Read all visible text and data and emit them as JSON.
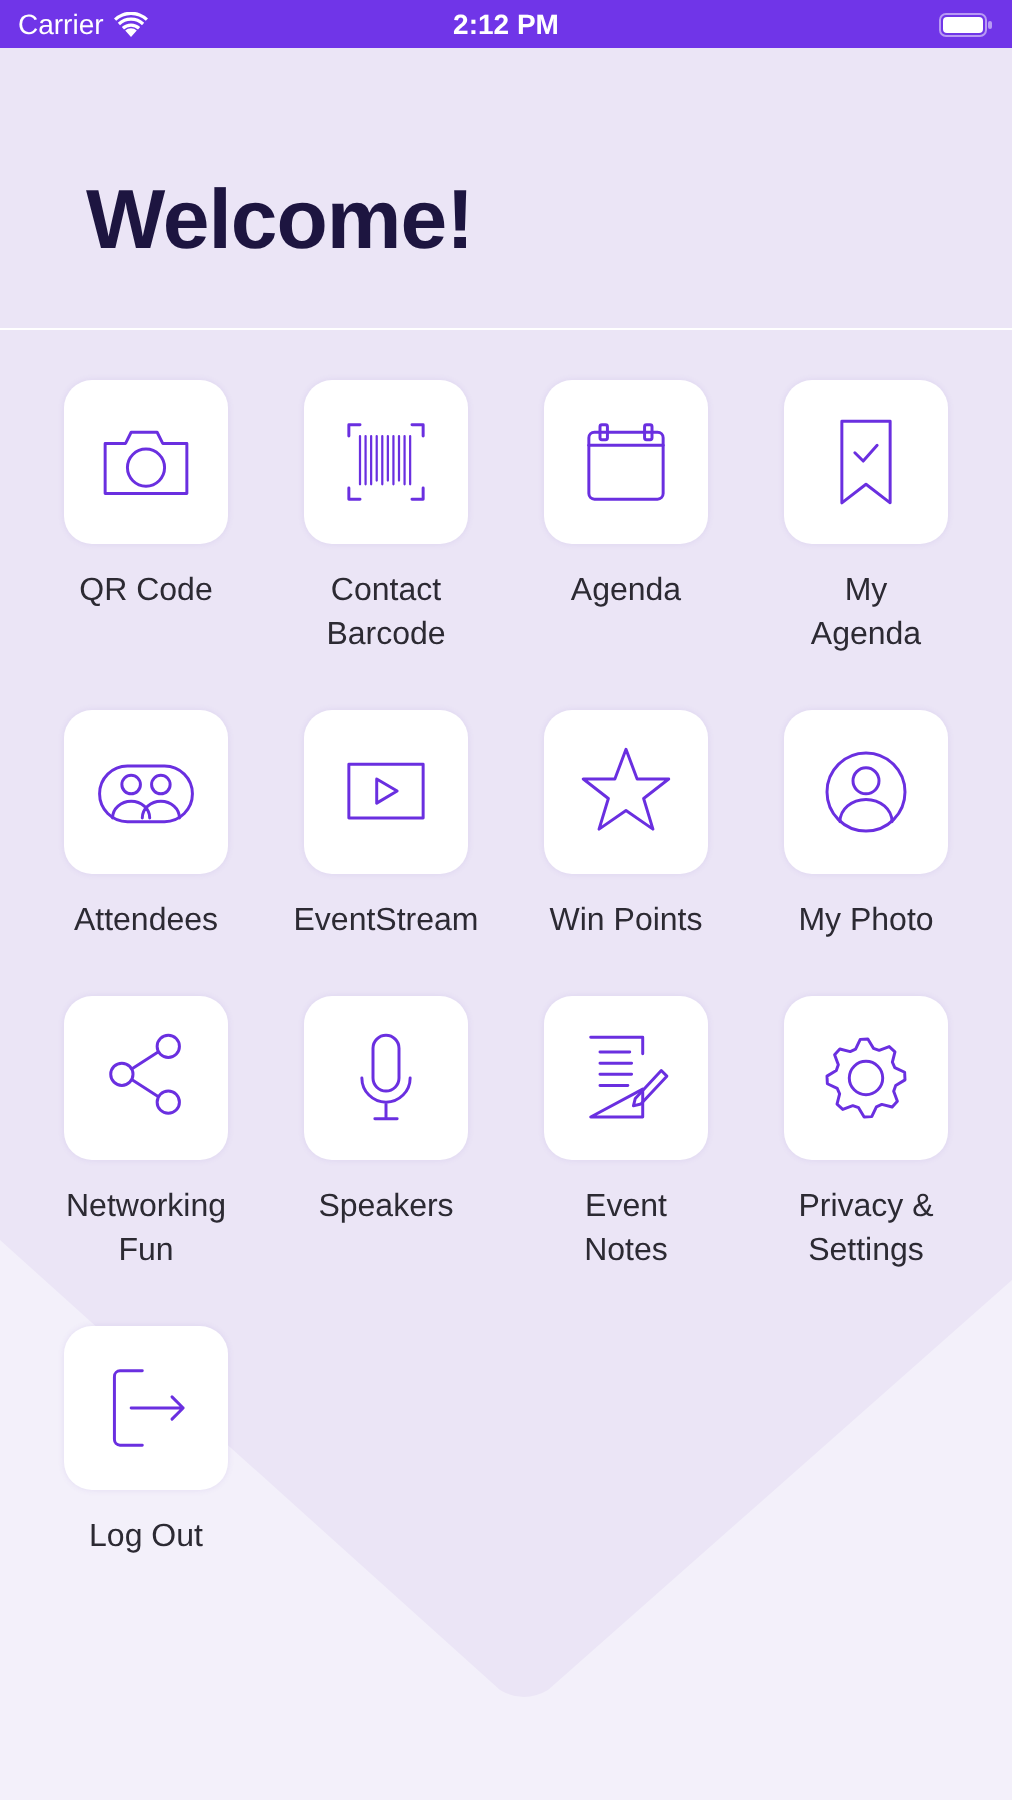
{
  "status_bar": {
    "carrier": "Carrier",
    "time": "2:12 PM"
  },
  "header": {
    "title": "Welcome!"
  },
  "menu": [
    {
      "label": "QR Code"
    },
    {
      "label": "Contact\nBarcode"
    },
    {
      "label": "Agenda"
    },
    {
      "label": "My\nAgenda"
    },
    {
      "label": "Attendees"
    },
    {
      "label": "EventStream"
    },
    {
      "label": "Win Points"
    },
    {
      "label": "My Photo"
    },
    {
      "label": "Networking\nFun"
    },
    {
      "label": "Speakers"
    },
    {
      "label": "Event\nNotes"
    },
    {
      "label": "Privacy &\nSettings"
    },
    {
      "label": "Log Out"
    }
  ]
}
